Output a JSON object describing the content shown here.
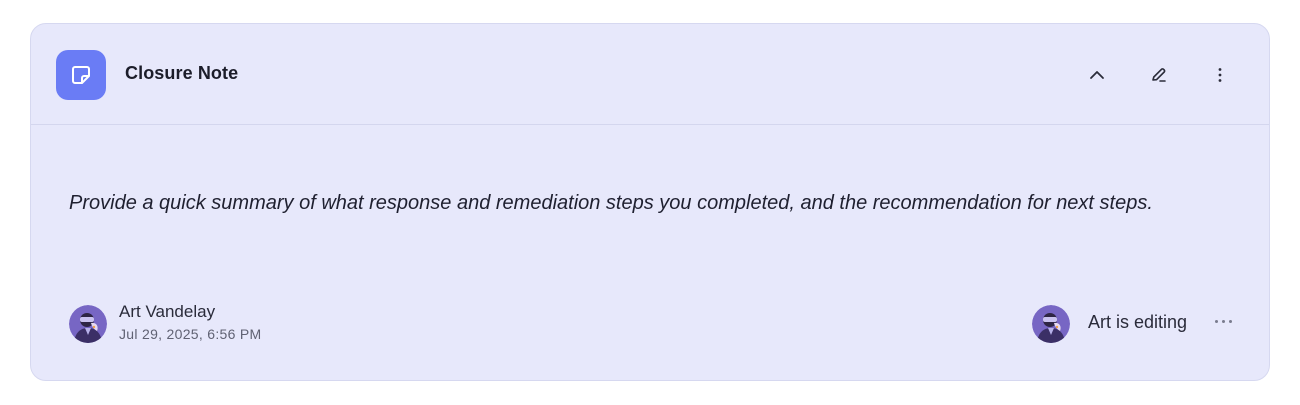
{
  "note": {
    "title": "Closure Note",
    "icon": "sticky-note-icon",
    "accent_color": "#6a7cf5",
    "background_color": "#e7e8fb",
    "body": "Provide a quick summary of what response and remediation steps you completed, and the recommendation for next steps.",
    "actions": [
      {
        "name": "collapse",
        "icon": "chevron-up-icon"
      },
      {
        "name": "edit",
        "icon": "pencil-icon"
      },
      {
        "name": "more",
        "icon": "more-vertical-icon"
      }
    ]
  },
  "author": {
    "name": "Art Vandelay",
    "timestamp": "Jul 29, 2025, 6:56 PM",
    "avatar_icon": "avatar"
  },
  "presence": {
    "status": "Art is editing",
    "indicator_icon": "typing-dots-icon"
  }
}
